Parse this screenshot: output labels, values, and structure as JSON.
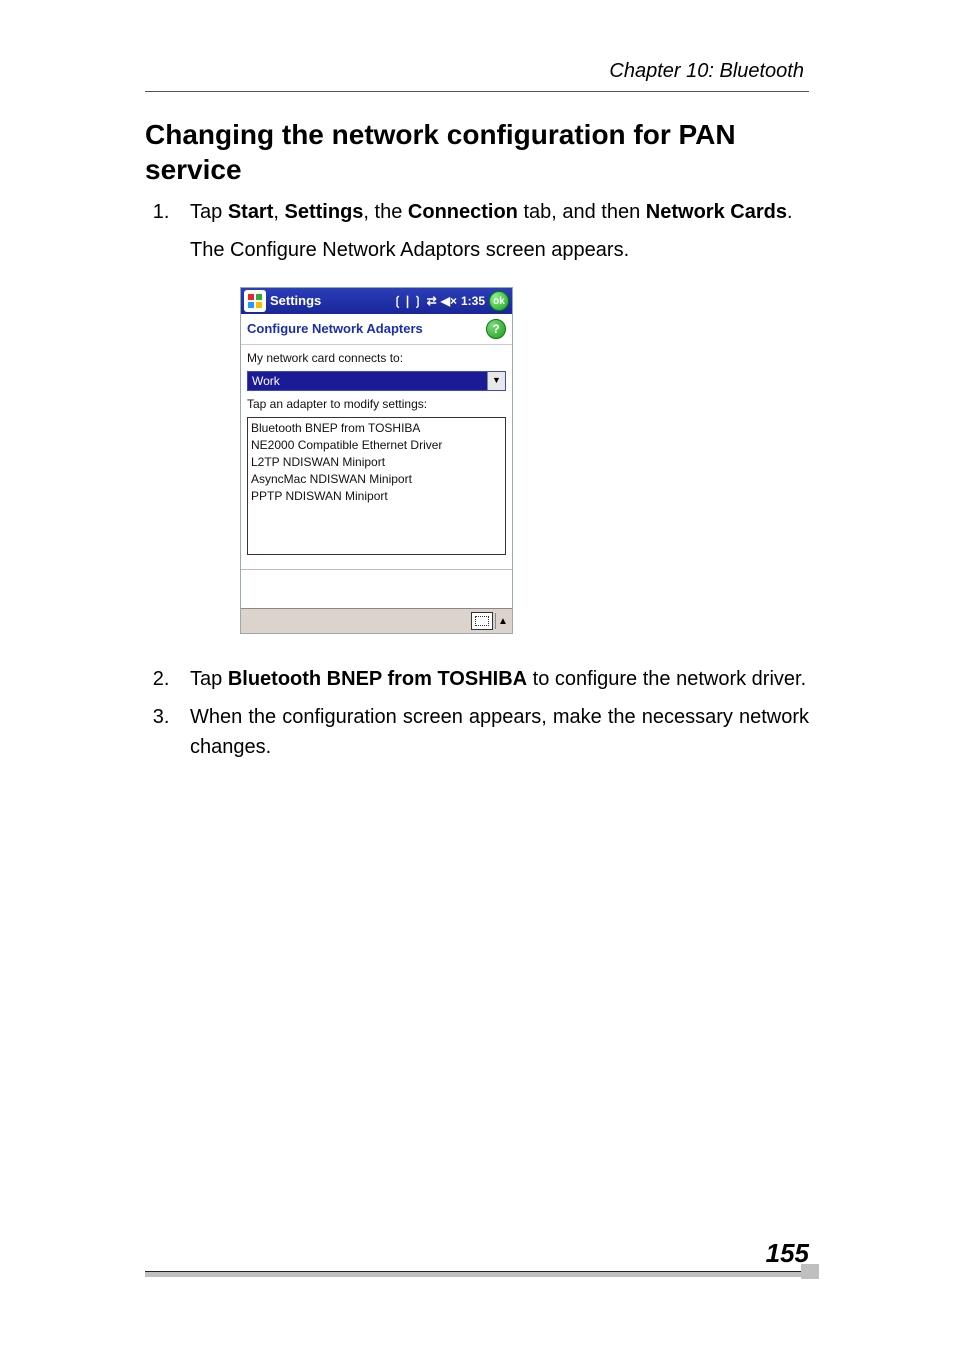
{
  "header": {
    "chapter": "Chapter 10: Bluetooth"
  },
  "title": "Changing the network configuration for PAN service",
  "steps": {
    "s1": {
      "segments": [
        {
          "t": "Tap "
        },
        {
          "t": "Start",
          "b": true
        },
        {
          "t": ", "
        },
        {
          "t": "Settings",
          "b": true
        },
        {
          "t": ", the "
        },
        {
          "t": "Connection",
          "b": true
        },
        {
          "t": " tab, and then "
        },
        {
          "t": "Network Cards",
          "b": true
        },
        {
          "t": "."
        }
      ],
      "sub": "The Configure Network Adaptors screen appears."
    },
    "s2": {
      "segments": [
        {
          "t": "Tap "
        },
        {
          "t": "Bluetooth BNEP from TOSHIBA",
          "b": true
        },
        {
          "t": " to configure the network driver."
        }
      ]
    },
    "s3": {
      "text": "When the configuration screen appears, make the necessary network changes."
    }
  },
  "pda": {
    "title": "Settings",
    "time": "1:35",
    "ok": "ok",
    "subbar": "Configure Network Adapters",
    "help": "?",
    "label1": "My network card connects to:",
    "select_value": "Work",
    "label2": "Tap an adapter to modify settings:",
    "adapters": [
      "Bluetooth BNEP from TOSHIBA",
      "NE2000 Compatible Ethernet Driver",
      "L2TP NDISWAN Miniport",
      "AsyncMac NDISWAN Miniport",
      "PPTP NDISWAN Miniport"
    ]
  },
  "footer": {
    "page_number": "155"
  }
}
